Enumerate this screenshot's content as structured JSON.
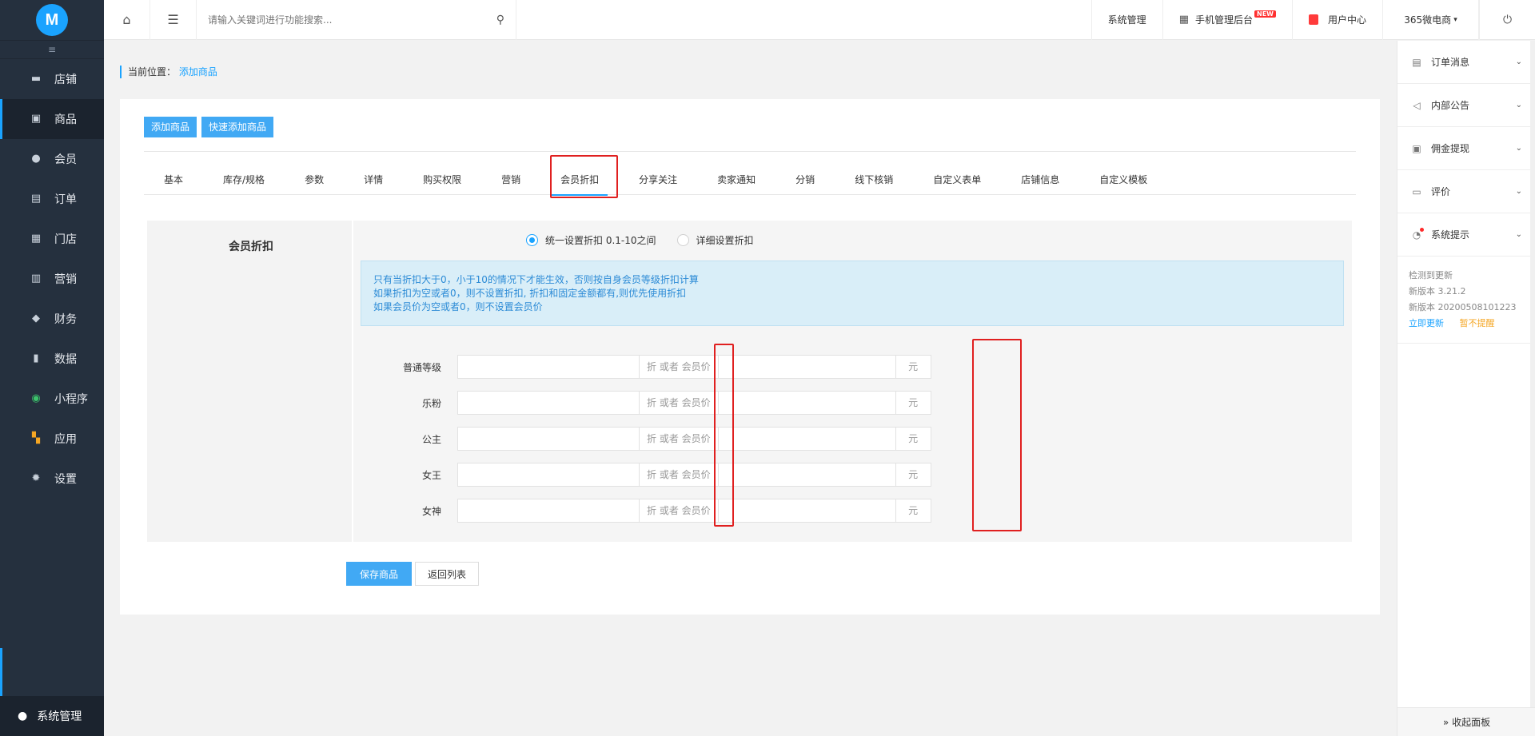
{
  "sidebar": {
    "logo_text": "M",
    "items": [
      {
        "label": "店铺",
        "icon": "store-icon"
      },
      {
        "label": "商品",
        "icon": "goods-icon"
      },
      {
        "label": "会员",
        "icon": "user-icon"
      },
      {
        "label": "订单",
        "icon": "order-icon"
      },
      {
        "label": "门店",
        "icon": "shop-icon"
      },
      {
        "label": "营销",
        "icon": "gift-icon"
      },
      {
        "label": "财务",
        "icon": "money-icon"
      },
      {
        "label": "数据",
        "icon": "chart-icon"
      },
      {
        "label": "小程序",
        "icon": "miniapp-icon"
      },
      {
        "label": "应用",
        "icon": "apps-icon"
      },
      {
        "label": "设置",
        "icon": "gear-icon"
      }
    ],
    "active_index": 1,
    "bottom_label": "系统管理"
  },
  "topbar": {
    "search_placeholder": "请输入关键词进行功能搜索...",
    "system_manage": "系统管理",
    "mobile_admin": "手机管理后台",
    "new_badge": "NEW",
    "user_center": "用户中心",
    "shop_name": "365微电商"
  },
  "breadcrumb": {
    "prefix": "当前位置：",
    "current": "添加商品"
  },
  "actions": {
    "add_goods": "添加商品",
    "quick_add_goods": "快速添加商品"
  },
  "tabs": [
    "基本",
    "库存/规格",
    "参数",
    "详情",
    "购买权限",
    "营销",
    "会员折扣",
    "分享关注",
    "卖家通知",
    "分销",
    "线下核销",
    "自定义表单",
    "店铺信息",
    "自定义模板"
  ],
  "active_tab": 6,
  "form": {
    "section_label": "会员折扣",
    "radio_unified": "统一设置折扣 0.1-10之间",
    "radio_detailed": "详细设置折扣",
    "info_lines": [
      "只有当折扣大于0，小于10的情况下才能生效，否则按自身会员等级折扣计算",
      "如果折扣为空或者0，则不设置折扣, 折扣和固定金额都有,则优先使用折扣",
      "如果会员价为空或者0，则不设置会员价"
    ],
    "addon_middle": "折 或者 会员价",
    "addon_unit": "元",
    "levels": [
      "普通等级",
      "乐粉",
      "公主",
      "女王",
      "女神"
    ]
  },
  "buttons": {
    "save": "保存商品",
    "back": "返回列表"
  },
  "right_panel": {
    "items": [
      {
        "label": "订单消息",
        "icon": "clipboard-icon"
      },
      {
        "label": "内部公告",
        "icon": "speaker-icon"
      },
      {
        "label": "佣金提现",
        "icon": "wallet-icon"
      },
      {
        "label": "评价",
        "icon": "comment-icon"
      },
      {
        "label": "系统提示",
        "icon": "bell-icon"
      }
    ],
    "update_detected": "检测到更新",
    "new_version": "新版本 3.21.2",
    "new_build": "新版本 20200508101223",
    "update_now": "立即更新",
    "remind_later": "暂不提醒",
    "collapse": "» 收起面板"
  },
  "colors": {
    "accent": "#1aa3ff",
    "sidebar_bg": "#25303e",
    "highlight": "#e02020"
  }
}
